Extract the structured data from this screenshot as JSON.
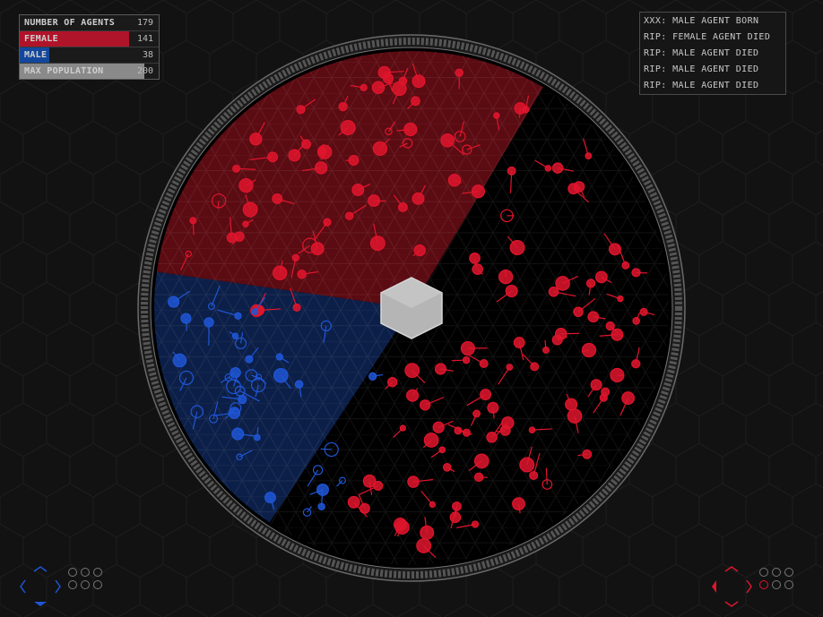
{
  "stats": {
    "rows": [
      {
        "label": "NUMBER OF AGENTS",
        "value": "179",
        "fill": 0,
        "color": "#1a1a1a"
      },
      {
        "label": "FEMALE",
        "value": "141",
        "fill": 0.79,
        "color": "#b0142a"
      },
      {
        "label": "MALE",
        "value": "38",
        "fill": 0.21,
        "color": "#13479c"
      },
      {
        "label": "MAX POPULATION",
        "value": "200",
        "fill": 0.895,
        "color": "#8a8a8a"
      }
    ]
  },
  "event_log": [
    "XXX: MALE AGENT BORN",
    "RIP: FEMALE AGENT DIED",
    "RIP: MALE AGENT DIED",
    "RIP: MALE AGENT DIED",
    "RIP: MALE AGENT DIED"
  ],
  "colors": {
    "female": "#e0152d",
    "male": "#1f56d6",
    "background": "#121212",
    "arena": "#000000",
    "hub": "#b8b8b8"
  },
  "arena": {
    "female_zone_color": "#7a0f18",
    "male_zone_color": "#0d2250"
  },
  "controls": {
    "left": {
      "icon": "dpad-blue-icon",
      "color": "#1f56d6",
      "slots_filled": [
        0,
        0,
        0,
        0,
        0,
        0
      ]
    },
    "right": {
      "icon": "dpad-red-icon",
      "color": "#e0152d",
      "slots_filled": [
        0,
        0,
        0,
        1,
        0,
        0
      ]
    }
  }
}
